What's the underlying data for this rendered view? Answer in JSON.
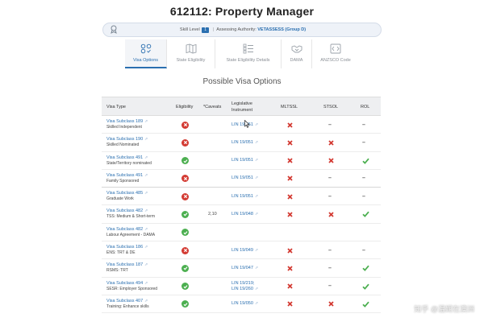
{
  "page": {
    "title": "612112: Property Manager"
  },
  "info_bar": {
    "skill_level_label": "Skill Level",
    "skill_level_value": "1",
    "separator": "|",
    "authority_label": "Assessing Authority:",
    "authority_value": "VETASSESS (Group D)"
  },
  "tabs": [
    {
      "label": "Visa Options",
      "icon": "visa-options-icon",
      "active": true
    },
    {
      "label": "State Eligibility",
      "icon": "map-icon",
      "active": false
    },
    {
      "label": "State Eligibility Details",
      "icon": "list-details-icon",
      "active": false
    },
    {
      "label": "DAMA",
      "icon": "handshake-icon",
      "active": false
    },
    {
      "label": "ANZSCO Code",
      "icon": "code-box-icon",
      "active": false
    }
  ],
  "section": {
    "title": "Possible Visa Options"
  },
  "table": {
    "headers": {
      "visa_type": "Visa Type",
      "eligibility": "Eligibility",
      "caveats": "*Caveats",
      "legislative_1": "Legislative",
      "legislative_2": "Instrument",
      "mltssl": "MLTSSL",
      "stsol": "STSOL",
      "rol": "ROL"
    },
    "rows": [
      {
        "name": "Visa Subclass 189",
        "desc": "Skilled Independent",
        "eligibility": "no",
        "caveats": "",
        "legislative": [
          "LIN 19/051"
        ],
        "mltssl": "x",
        "stsol": "dash",
        "rol": "dash",
        "group_end": false
      },
      {
        "name": "Visa Subclass 190",
        "desc": "Skilled Nominated",
        "eligibility": "no",
        "caveats": "",
        "legislative": [
          "LIN 19/051"
        ],
        "mltssl": "x",
        "stsol": "x",
        "rol": "dash",
        "group_end": false
      },
      {
        "name": "Visa Subclass 491",
        "desc": "State/Territory nominated",
        "eligibility": "yes",
        "caveats": "",
        "legislative": [
          "LIN 19/051"
        ],
        "mltssl": "x",
        "stsol": "x",
        "rol": "tick",
        "group_end": false
      },
      {
        "name": "Visa Subclass 491",
        "desc": "Family Sponsored",
        "eligibility": "no",
        "caveats": "",
        "legislative": [
          "LIN 19/051"
        ],
        "mltssl": "x",
        "stsol": "dash",
        "rol": "dash",
        "group_end": true
      },
      {
        "name": "Visa Subclass 485",
        "desc": "Graduate Work",
        "eligibility": "no",
        "caveats": "",
        "legislative": [
          "LIN 19/051"
        ],
        "mltssl": "x",
        "stsol": "dash",
        "rol": "dash",
        "group_end": false
      },
      {
        "name": "Visa Subclass 482",
        "desc": "TSS: Medium & Short-term",
        "eligibility": "yes",
        "caveats": "2,10",
        "legislative": [
          "LIN 19/048"
        ],
        "mltssl": "x",
        "stsol": "x",
        "rol": "tick",
        "group_end": false
      },
      {
        "name": "Visa Subclass 482",
        "desc": "Labour Agreement - DAMA",
        "eligibility": "yes",
        "caveats": "",
        "legislative": [],
        "mltssl": "none",
        "stsol": "none",
        "rol": "none",
        "group_end": false
      },
      {
        "name": "Visa Subclass 186",
        "desc": "ENS: TRT & DE",
        "eligibility": "no",
        "caveats": "",
        "legislative": [
          "LIN 19/049"
        ],
        "mltssl": "x",
        "stsol": "dash",
        "rol": "dash",
        "group_end": false
      },
      {
        "name": "Visa Subclass 187",
        "desc": "RSMS: TRT",
        "eligibility": "yes",
        "caveats": "",
        "legislative": [
          "LIN 19/047"
        ],
        "mltssl": "x",
        "stsol": "dash",
        "rol": "tick",
        "group_end": false
      },
      {
        "name": "Visa Subclass 494",
        "desc": "SESR: Employer Sponsored",
        "eligibility": "yes",
        "caveats": "",
        "legislative": [
          "LIN 19/219;",
          "LIN 19/260"
        ],
        "mltssl": "x",
        "stsol": "dash",
        "rol": "tick",
        "group_end": false
      },
      {
        "name": "Visa Subclass 407",
        "desc": "Training: Enhance skills",
        "eligibility": "yes",
        "caveats": "",
        "legislative": [
          "LIN 19/050"
        ],
        "mltssl": "x",
        "stsol": "x",
        "rol": "tick",
        "group_end": false
      }
    ]
  },
  "watermark": {
    "text": "知乎 @温妮在澳洲"
  },
  "colors": {
    "accent": "#2a6fb0",
    "red": "#d33a32",
    "green": "#4caf50"
  }
}
